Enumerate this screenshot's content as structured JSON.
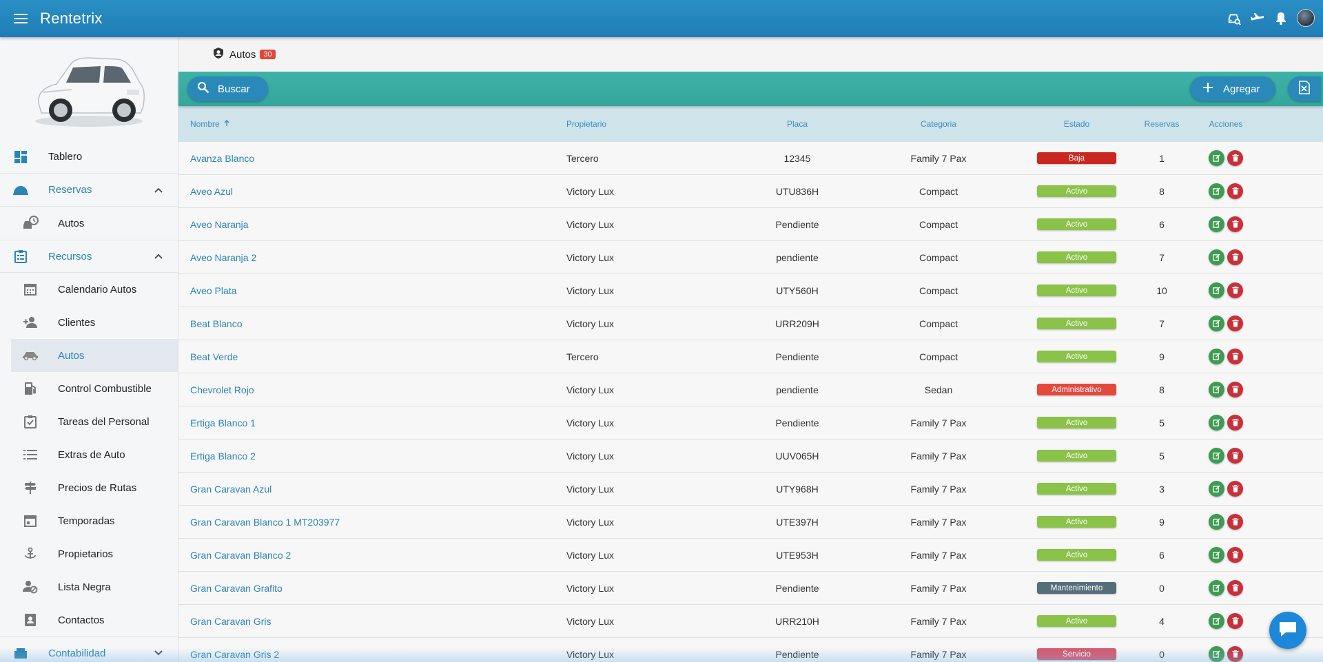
{
  "app": {
    "title": "Rentetrix"
  },
  "breadcrumb": {
    "label": "Autos",
    "count": "30"
  },
  "toolbar": {
    "search_label": "Buscar",
    "add_label": "Agregar"
  },
  "sidebar": {
    "top": [
      {
        "label": "Tablero",
        "icon": "dashboard-icon"
      }
    ],
    "groups": [
      {
        "label": "Reservas",
        "icon": "reservations-icon",
        "expanded": true,
        "items": [
          {
            "label": "Autos",
            "icon": "car-clock-icon"
          }
        ]
      },
      {
        "label": "Recursos",
        "icon": "clipboard-icon",
        "expanded": true,
        "items": [
          {
            "label": "Calendario Autos",
            "icon": "calendar-icon"
          },
          {
            "label": "Clientes",
            "icon": "add-person-icon"
          },
          {
            "label": "Autos",
            "icon": "car-icon",
            "active": true
          },
          {
            "label": "Control Combustible",
            "icon": "fuel-icon"
          },
          {
            "label": "Tareas del Personal",
            "icon": "tasks-icon"
          },
          {
            "label": "Extras de Auto",
            "icon": "list-icon"
          },
          {
            "label": "Precios de Rutas",
            "icon": "signpost-icon"
          },
          {
            "label": "Temporadas",
            "icon": "calendar-icon"
          },
          {
            "label": "Propietarios",
            "icon": "anchor-icon"
          },
          {
            "label": "Lista Negra",
            "icon": "person-block-icon"
          },
          {
            "label": "Contactos",
            "icon": "contact-card-icon"
          }
        ]
      },
      {
        "label": "Contabilidad",
        "icon": "accounting-icon",
        "expanded": false,
        "items": []
      }
    ]
  },
  "table": {
    "columns": {
      "name": "Nombre",
      "owner": "Propietario",
      "plate": "Placa",
      "category": "Categoria",
      "status": "Estado",
      "reservations": "Reservas",
      "actions": "Acciones"
    },
    "status_colors": {
      "Baja": "#c9271f",
      "Activo": "#8bc34a",
      "Administrativo": "#e5483d",
      "Mantenimiento": "#546e7a",
      "Servicio": "#d9566a"
    },
    "rows": [
      {
        "name": "Avanza Blanco",
        "owner": "Tercero",
        "plate": "12345",
        "category": "Family 7 Pax",
        "status": "Baja",
        "reservations": "1"
      },
      {
        "name": "Aveo Azul",
        "owner": "Victory Lux",
        "plate": "UTU836H",
        "category": "Compact",
        "status": "Activo",
        "reservations": "8"
      },
      {
        "name": "Aveo Naranja",
        "owner": "Victory Lux",
        "plate": "Pendiente",
        "category": "Compact",
        "status": "Activo",
        "reservations": "6"
      },
      {
        "name": "Aveo Naranja 2",
        "owner": "Victory Lux",
        "plate": "pendiente",
        "category": "Compact",
        "status": "Activo",
        "reservations": "7"
      },
      {
        "name": "Aveo Plata",
        "owner": "Victory Lux",
        "plate": "UTY560H",
        "category": "Compact",
        "status": "Activo",
        "reservations": "10"
      },
      {
        "name": "Beat Blanco",
        "owner": "Victory Lux",
        "plate": "URR209H",
        "category": "Compact",
        "status": "Activo",
        "reservations": "7"
      },
      {
        "name": "Beat Verde",
        "owner": "Tercero",
        "plate": "Pendiente",
        "category": "Compact",
        "status": "Activo",
        "reservations": "9"
      },
      {
        "name": "Chevrolet Rojo",
        "owner": "Victory Lux",
        "plate": "pendiente",
        "category": "Sedan",
        "status": "Administrativo",
        "reservations": "8"
      },
      {
        "name": "Ertiga Blanco 1",
        "owner": "Victory Lux",
        "plate": "Pendiente",
        "category": "Family 7 Pax",
        "status": "Activo",
        "reservations": "5"
      },
      {
        "name": "Ertiga Blanco 2",
        "owner": "Victory Lux",
        "plate": "UUV065H",
        "category": "Family 7 Pax",
        "status": "Activo",
        "reservations": "5"
      },
      {
        "name": "Gran Caravan Azul",
        "owner": "Victory Lux",
        "plate": "UTY968H",
        "category": "Family 7 Pax",
        "status": "Activo",
        "reservations": "3"
      },
      {
        "name": "Gran Caravan Blanco 1 MT203977",
        "owner": "Victory Lux",
        "plate": "UTE397H",
        "category": "Family 7 Pax",
        "status": "Activo",
        "reservations": "9"
      },
      {
        "name": "Gran Caravan Blanco 2",
        "owner": "Victory Lux",
        "plate": "UTE953H",
        "category": "Family 7 Pax",
        "status": "Activo",
        "reservations": "6"
      },
      {
        "name": "Gran Caravan Grafito",
        "owner": "Victory Lux",
        "plate": "Pendiente",
        "category": "Family 7 Pax",
        "status": "Mantenimiento",
        "reservations": "0"
      },
      {
        "name": "Gran Caravan Gris",
        "owner": "Victory Lux",
        "plate": "URR210H",
        "category": "Family 7 Pax",
        "status": "Activo",
        "reservations": "4"
      },
      {
        "name": "Gran Caravan Gris 2",
        "owner": "Victory Lux",
        "plate": "Pendiente",
        "category": "Family 7 Pax",
        "status": "Servicio",
        "reservations": "0"
      }
    ]
  }
}
